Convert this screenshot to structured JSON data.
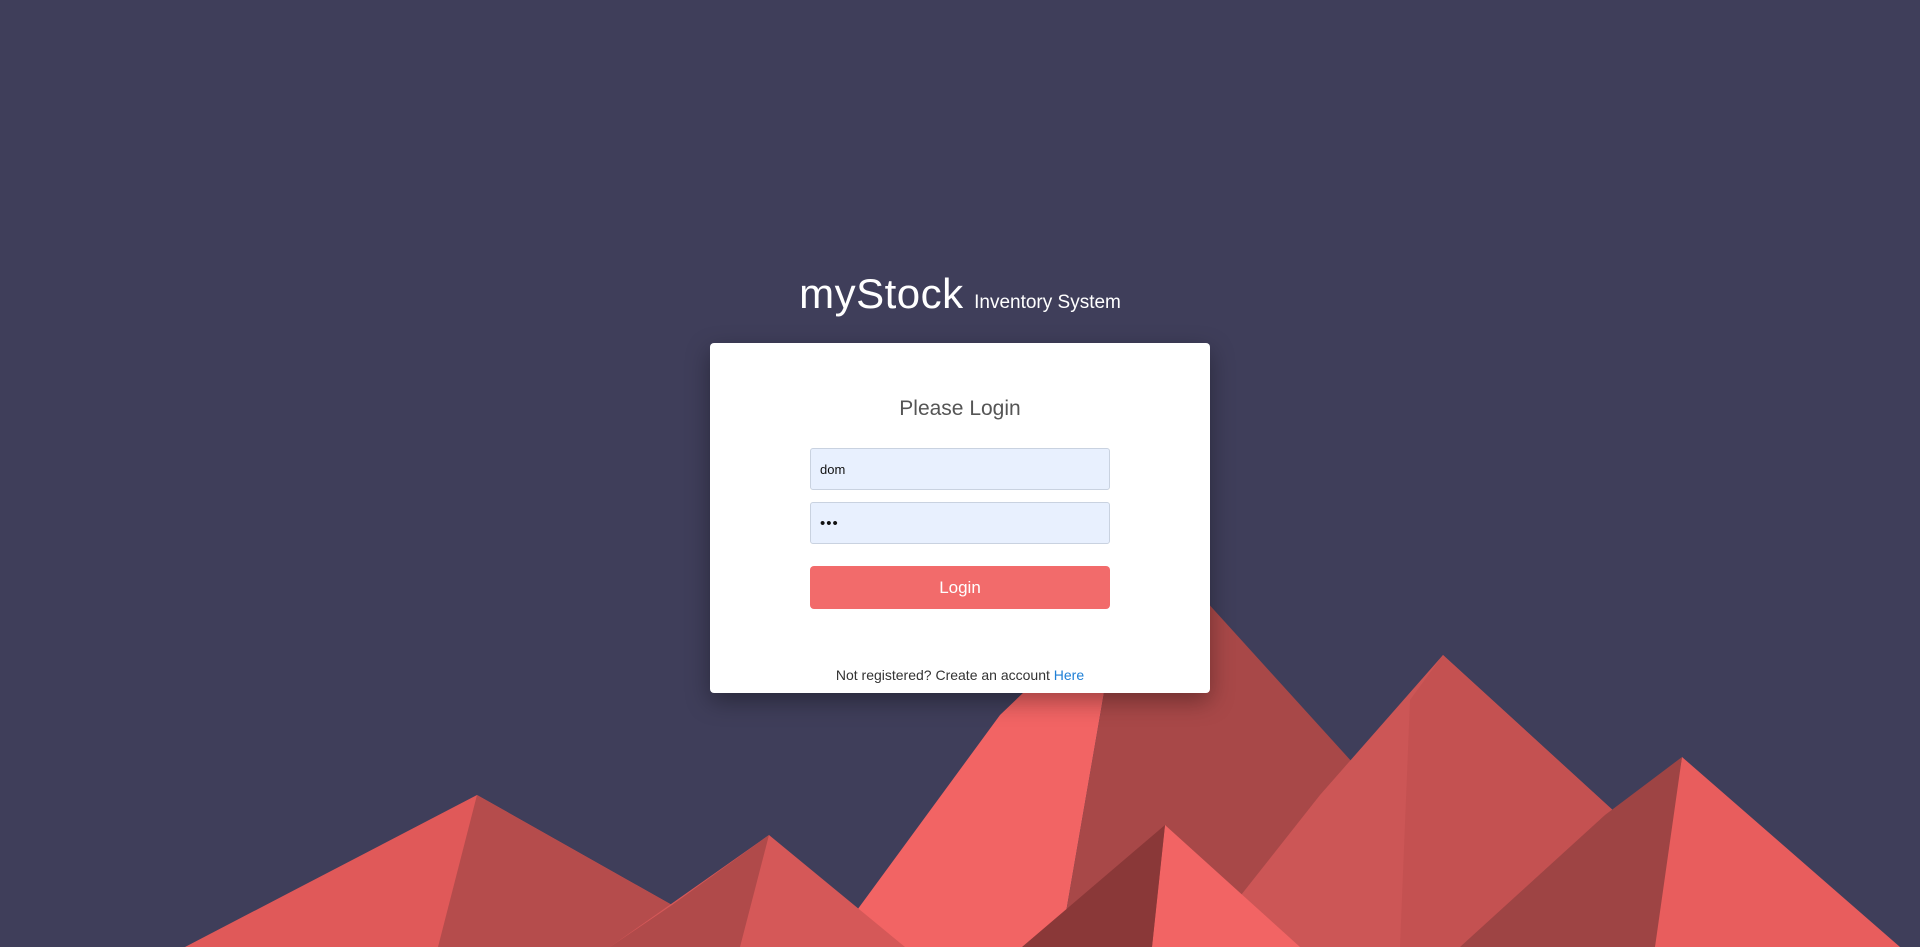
{
  "brand": {
    "title": "myStock",
    "subtitle": "Inventory System"
  },
  "login_form": {
    "heading": "Please Login",
    "username_value": "dom",
    "password_value": "***",
    "submit_label": "Login"
  },
  "register": {
    "prompt": "Not registered? Create an account ",
    "link_label": "Here"
  },
  "colors": {
    "background": "#3f3e5a",
    "accent": "#f26b6b",
    "input_fill": "#e8f0fe",
    "link": "#1e7fd6"
  }
}
